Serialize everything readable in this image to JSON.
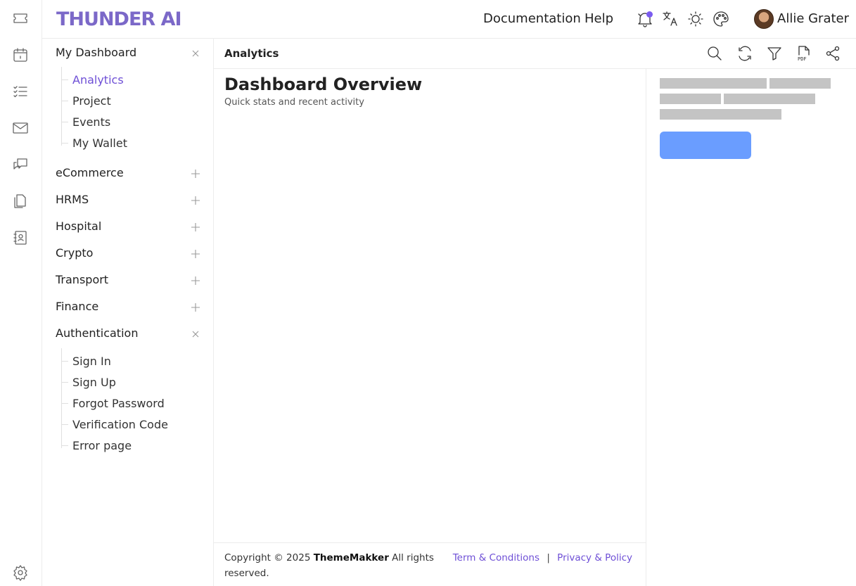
{
  "brand": {
    "logo": "THUNDER AI",
    "accent": "#6e4fd6",
    "logo_color": "#7b68c8"
  },
  "rail": {
    "icons": [
      "ticket-icon",
      "calendar-icon",
      "checklist-icon",
      "mail-icon",
      "chat-icon",
      "files-icon",
      "contacts-icon",
      "settings-icon"
    ]
  },
  "topbar": {
    "links": {
      "documentation": "Documentation",
      "help": "Help"
    },
    "icons": [
      "bell-icon",
      "translate-icon",
      "sun-icon",
      "palette-icon"
    ],
    "user": {
      "name": "Allie Grater"
    }
  },
  "nav": {
    "sections": [
      {
        "label": "My Dashboard",
        "expanded": true,
        "items": [
          "Analytics",
          "Project",
          "Events",
          "My Wallet"
        ],
        "active": "Analytics"
      },
      {
        "label": "eCommerce",
        "expanded": false
      },
      {
        "label": "HRMS",
        "expanded": false
      },
      {
        "label": "Hospital",
        "expanded": false
      },
      {
        "label": "Crypto",
        "expanded": false
      },
      {
        "label": "Transport",
        "expanded": false
      },
      {
        "label": "Finance",
        "expanded": false
      },
      {
        "label": "Authentication",
        "expanded": true,
        "items": [
          "Sign In",
          "Sign Up",
          "Forgot Password",
          "Verification Code",
          "Error page"
        ]
      }
    ]
  },
  "pagebar": {
    "title": "Analytics",
    "icons": [
      "search-icon",
      "refresh-icon",
      "filter-icon",
      "pdf-icon",
      "share-icon"
    ]
  },
  "main": {
    "heading": "Dashboard Overview",
    "subheading": "Quick stats and recent activity"
  },
  "footer": {
    "copyright_prefix": "Copyright © 2025 ",
    "company": "ThemeMakker",
    "copyright_suffix": " All rights reserved.",
    "terms": "Term & Conditions",
    "separator": "|",
    "privacy": "Privacy & Policy"
  },
  "skeleton": {
    "bar_color": "#c4c4c4",
    "button_color": "#6a9dff"
  }
}
